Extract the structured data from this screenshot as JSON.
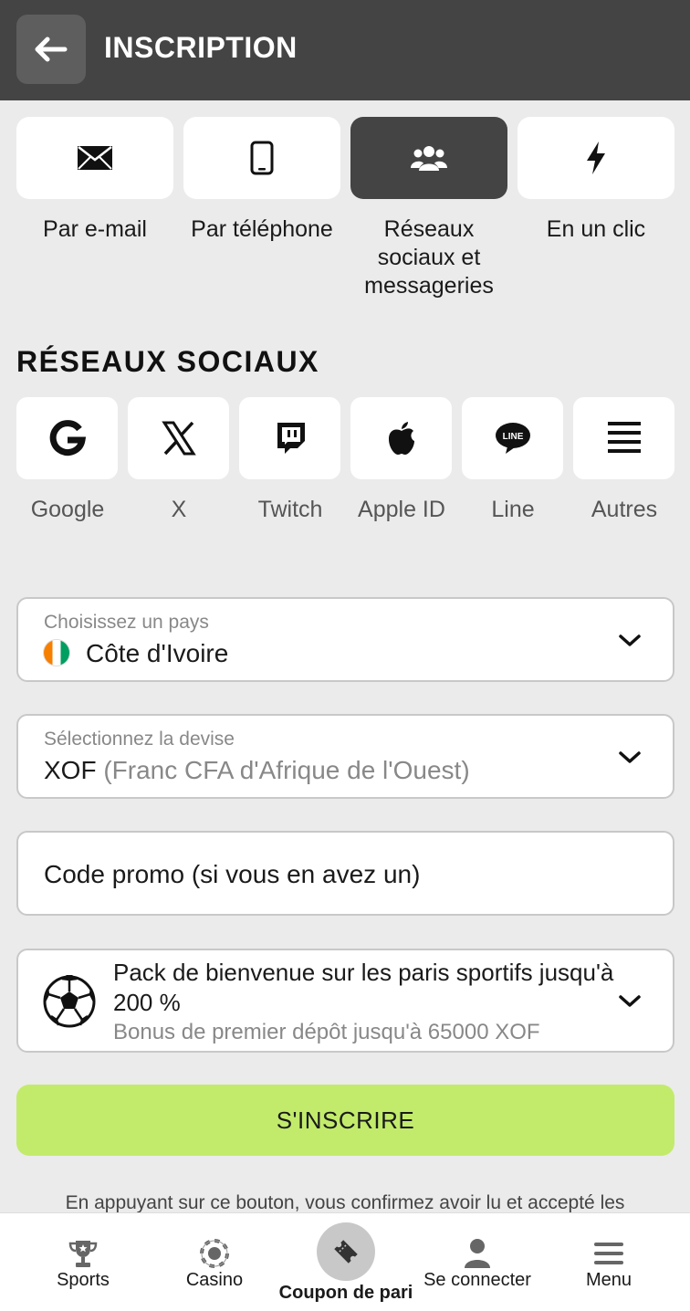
{
  "header": {
    "title": "INSCRIPTION"
  },
  "methods": [
    {
      "label": "Par e-mail",
      "icon": "envelope-icon",
      "active": false
    },
    {
      "label": "Par téléphone",
      "icon": "phone-icon",
      "active": false
    },
    {
      "label": "Réseaux sociaux et messageries",
      "icon": "users-icon",
      "active": true
    },
    {
      "label": "En un clic",
      "icon": "lightning-icon",
      "active": false
    }
  ],
  "social": {
    "title": "RÉSEAUX SOCIAUX",
    "items": [
      {
        "label": "Google",
        "icon": "google-icon"
      },
      {
        "label": "X",
        "icon": "x-icon"
      },
      {
        "label": "Twitch",
        "icon": "twitch-icon"
      },
      {
        "label": "Apple ID",
        "icon": "apple-icon"
      },
      {
        "label": "Line",
        "icon": "line-icon"
      },
      {
        "label": "Autres",
        "icon": "menu-lines-icon"
      }
    ]
  },
  "country": {
    "label": "Choisissez un pays",
    "value": "Côte d'Ivoire"
  },
  "currency": {
    "label": "Sélectionnez la devise",
    "code": "XOF",
    "name": "(Franc CFA d'Afrique de l'Ouest)"
  },
  "promo": {
    "placeholder": "Code promo (si vous en avez un)"
  },
  "bonus": {
    "title": "Pack de bienvenue sur les paris sportifs jusqu'à 200 %",
    "subtitle": "Bonus de premier dépôt jusqu'à 65000 XOF"
  },
  "submit": {
    "label": "S'INSCRIRE"
  },
  "terms": {
    "text": "En appuyant sur ce bouton, vous confirmez avoir lu et accepté les"
  },
  "nav": [
    {
      "label": "Sports",
      "icon": "trophy-icon"
    },
    {
      "label": "Casino",
      "icon": "casino-chip-icon"
    },
    {
      "label": "Coupon de pari",
      "icon": "ticket-icon"
    },
    {
      "label": "Se connecter",
      "icon": "user-icon"
    },
    {
      "label": "Menu",
      "icon": "hamburger-icon"
    }
  ],
  "colors": {
    "header": "#444444",
    "accent": "#c2eb6b",
    "background": "#ebebeb"
  }
}
